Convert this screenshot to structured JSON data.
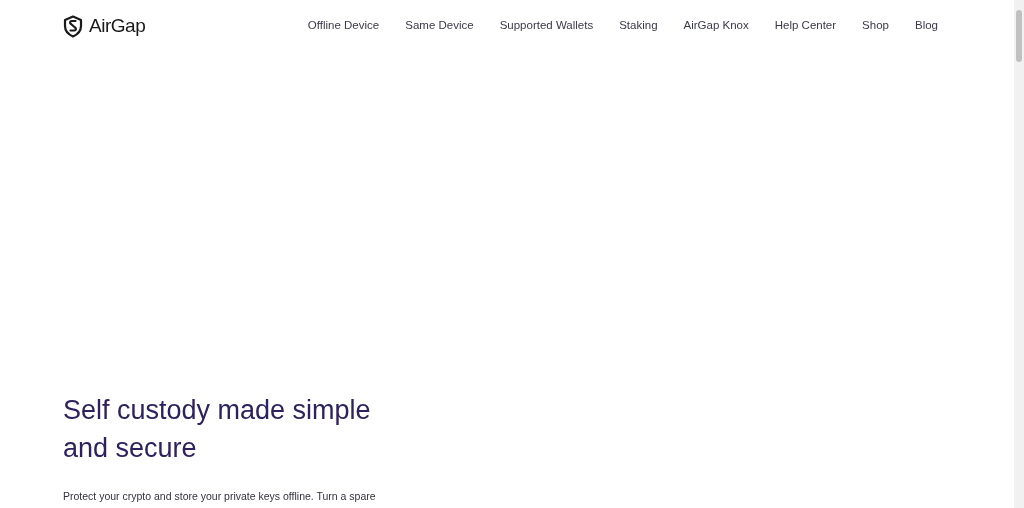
{
  "header": {
    "logo_text": "AirGap",
    "nav": [
      {
        "label": "Offline Device"
      },
      {
        "label": "Same Device"
      },
      {
        "label": "Supported Wallets"
      },
      {
        "label": "Staking"
      },
      {
        "label": "AirGap Knox"
      },
      {
        "label": "Help Center"
      },
      {
        "label": "Shop"
      },
      {
        "label": "Blog"
      }
    ]
  },
  "hero": {
    "headline": "Self custody made simple and secure",
    "text": "Protect your crypto and store your private keys offline. Turn a spare"
  }
}
